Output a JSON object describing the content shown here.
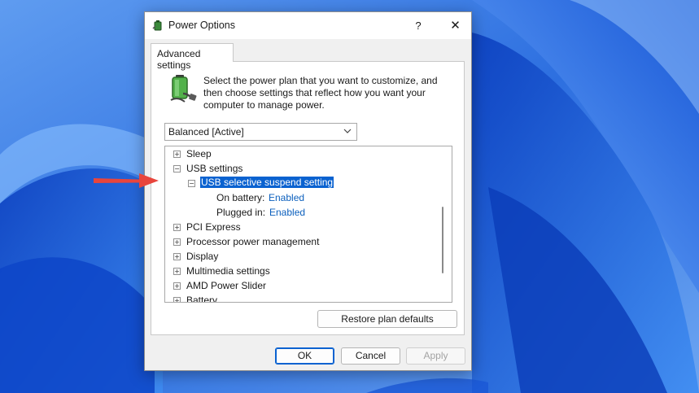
{
  "window": {
    "title": "Power Options",
    "help_label": "?",
    "close_label": "✕"
  },
  "tabs": [
    {
      "label": "Advanced settings"
    }
  ],
  "description": "Select the power plan that you want to customize, and then choose settings that reflect how you want your computer to manage power.",
  "plan_select": {
    "value": "Balanced [Active]"
  },
  "tree": {
    "items": [
      {
        "label": "Sleep",
        "toggle": "+"
      },
      {
        "label": "USB settings",
        "toggle": "−"
      },
      {
        "label": "USB selective suspend setting",
        "toggle": "−",
        "selected": true
      },
      {
        "label": "On battery:",
        "value": "Enabled"
      },
      {
        "label": "Plugged in:",
        "value": "Enabled"
      },
      {
        "label": "PCI Express",
        "toggle": "+"
      },
      {
        "label": "Processor power management",
        "toggle": "+"
      },
      {
        "label": "Display",
        "toggle": "+"
      },
      {
        "label": "Multimedia settings",
        "toggle": "+"
      },
      {
        "label": "AMD Power Slider",
        "toggle": "+"
      },
      {
        "label": "Battery",
        "toggle": "+"
      }
    ]
  },
  "buttons": {
    "restore": "Restore plan defaults",
    "ok": "OK",
    "cancel": "Cancel",
    "apply": "Apply"
  },
  "colors": {
    "wallpaper_blue": "#1f5fe0",
    "selection": "#0a62d0",
    "link_value": "#0b5fbd",
    "annotation_arrow": "#e8453c"
  },
  "icons": {
    "title_icon": "power-plan-icon",
    "plan_icon": "battery-plug-icon",
    "dropdown": "chevron-down-icon",
    "annotation": "red-arrow-icon"
  }
}
